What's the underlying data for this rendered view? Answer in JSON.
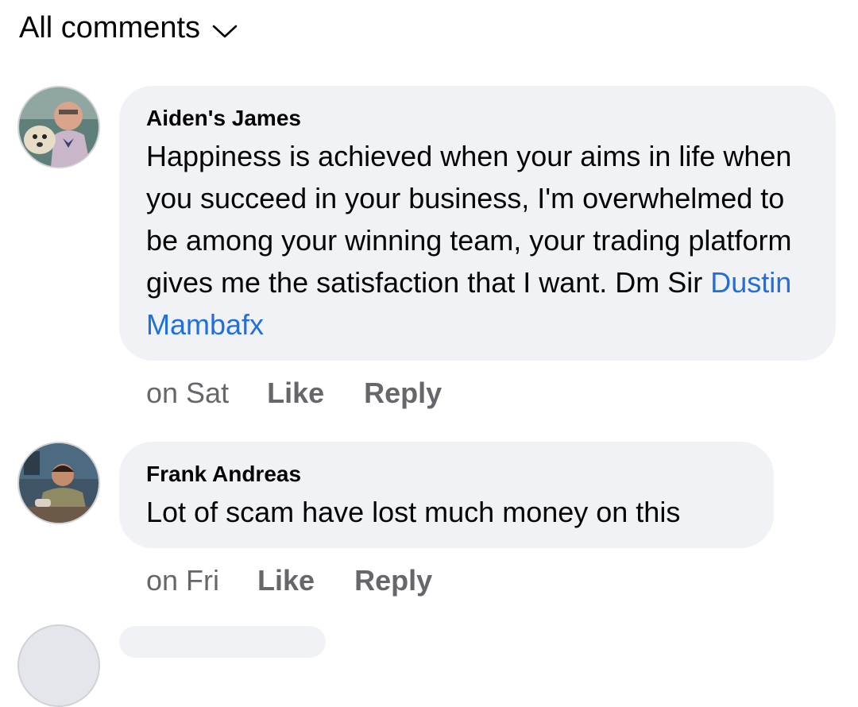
{
  "header": {
    "title": "All comments",
    "icon": "chevron-down-icon"
  },
  "comments": [
    {
      "author": "Aiden's James",
      "text": "Happiness is achieved when your aims in life when you succeed in your business, I'm overwhelmed to be among your winning team, your trading platform gives me the satisfaction that I want. Dm Sir ",
      "mention": "Dustin Mambafx",
      "time": "on Sat",
      "like_label": "Like",
      "reply_label": "Reply"
    },
    {
      "author": "Frank Andreas",
      "text": "Lot of scam have lost much money on this",
      "time": "on Fri",
      "like_label": "Like",
      "reply_label": "Reply"
    }
  ],
  "colors": {
    "bubble": "#f0f2f5",
    "mention": "#216fdb",
    "meta": "#65676b",
    "text": "#050505"
  }
}
